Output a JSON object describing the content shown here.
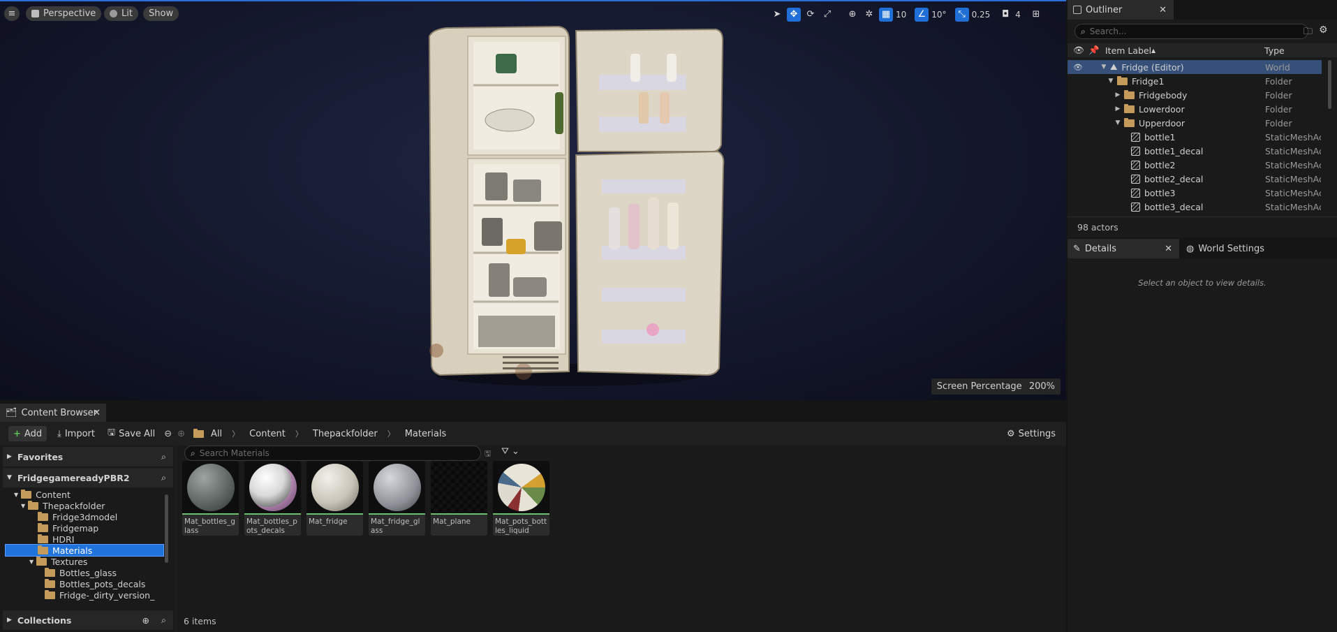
{
  "viewport": {
    "perspective_label": "Perspective",
    "lit_label": "Lit",
    "show_label": "Show",
    "grid_value": "10",
    "rotation_value": "10°",
    "scale_value": "0.25",
    "camera_speed": "4",
    "screen_percentage_label": "Screen Percentage",
    "screen_percentage_value": "200%"
  },
  "outliner": {
    "tab_label": "Outliner",
    "search_placeholder": "Search...",
    "col_label": "Item Label",
    "col_type": "Type",
    "rows": [
      {
        "label": "Fridge (Editor)",
        "type": "World"
      },
      {
        "label": "Fridge1",
        "type": "Folder"
      },
      {
        "label": "Fridgebody",
        "type": "Folder"
      },
      {
        "label": "Lowerdoor",
        "type": "Folder"
      },
      {
        "label": "Upperdoor",
        "type": "Folder"
      },
      {
        "label": "bottle1",
        "type": "StaticMeshActor"
      },
      {
        "label": "bottle1_decal",
        "type": "StaticMeshActor"
      },
      {
        "label": "bottle2",
        "type": "StaticMeshActor"
      },
      {
        "label": "bottle2_decal",
        "type": "StaticMeshActor"
      },
      {
        "label": "bottle3",
        "type": "StaticMeshActor"
      },
      {
        "label": "bottle3_decal",
        "type": "StaticMeshActor"
      }
    ],
    "actor_count": "98 actors"
  },
  "details": {
    "tab_label": "Details",
    "world_settings_label": "World Settings",
    "empty_message": "Select an object to view details."
  },
  "content_browser": {
    "tab_label": "Content Browser",
    "add_label": "Add",
    "import_label": "Import",
    "save_all_label": "Save All",
    "breadcrumb": [
      "All",
      "Content",
      "Thepackfolder",
      "Materials"
    ],
    "settings_label": "Settings",
    "favorites_label": "Favorites",
    "project_label": "FridgegamereadyPBR2",
    "collections_label": "Collections",
    "tree": [
      {
        "label": "Content"
      },
      {
        "label": "Thepackfolder"
      },
      {
        "label": "Fridge3dmodel"
      },
      {
        "label": "Fridgemap"
      },
      {
        "label": "HDRI"
      },
      {
        "label": "Materials"
      },
      {
        "label": "Textures"
      },
      {
        "label": "Bottles_glass"
      },
      {
        "label": "Bottles_pots_decals"
      },
      {
        "label": "Fridge-_dirty_version_"
      }
    ],
    "search_placeholder": "Search Materials",
    "assets": [
      {
        "label": "Mat_bottles_glass"
      },
      {
        "label": "Mat_bottles_pots_decals"
      },
      {
        "label": "Mat_fridge"
      },
      {
        "label": "Mat_fridge_glass"
      },
      {
        "label": "Mat_plane"
      },
      {
        "label": "Mat_pots_bottles_liquid"
      }
    ],
    "item_count": "6 items"
  },
  "colors": {
    "accent": "#1f73db",
    "selection": "#36507a",
    "folder": "#c49b5b",
    "asset_underline": "#6bc06a"
  }
}
